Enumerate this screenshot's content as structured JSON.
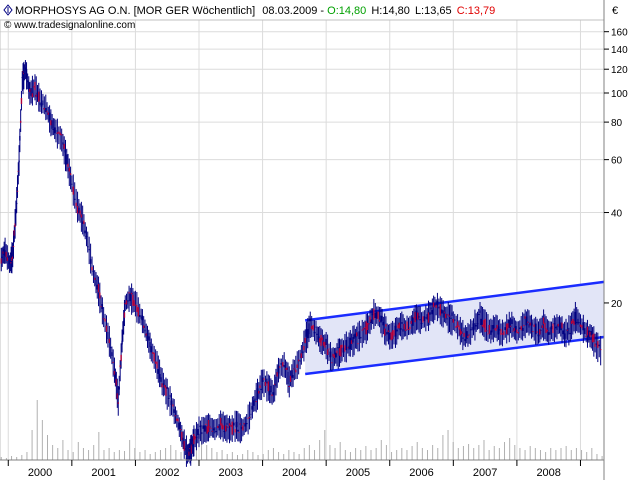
{
  "header": {
    "symbol_icon": "diamond-arrows-icon",
    "title": "MORPHOSYS AG O.N. [MOR GER  Wöchentlich]",
    "date": "08.03.2009",
    "open": "O:14,80",
    "high": "H:14,80",
    "low": "L:13,65",
    "close": "C:13,79",
    "watermark": "© www.tradesignalonline.com",
    "currency": "€"
  },
  "colors": {
    "background": "#ffffff",
    "grid": "#dcdcdc",
    "candle": "#000080",
    "candle_down": "#b0003a",
    "channel_line": "#1a2cff",
    "channel_fill": "#e2e5f7",
    "open_color": "#00a000",
    "close_color": "#e00000",
    "volume": "#b0b0b0"
  },
  "chart_data": {
    "type": "candlestick",
    "title": "MORPHOSYS AG O.N. [MOR GER  Wöchentlich]",
    "y_scale": "log",
    "ylim": [
      6,
      175
    ],
    "xlim": [
      1999.7,
      2009.2
    ],
    "y_ticks": [
      160,
      140,
      120,
      100,
      80,
      60,
      40,
      20
    ],
    "y_tick_labels": [
      "160",
      "140",
      "120",
      "100",
      "80",
      "60",
      "40",
      "20"
    ],
    "x_year_ticks": [
      1999.83,
      2000.83,
      2001.83,
      2002.83,
      2003.83,
      2004.83,
      2005.83,
      2006.83,
      2007.83,
      2008.83
    ],
    "year_labels": [
      {
        "label": "2000",
        "x": 2000.33
      },
      {
        "label": "2001",
        "x": 2001.33
      },
      {
        "label": "2002",
        "x": 2002.33
      },
      {
        "label": "2003",
        "x": 2003.33
      },
      {
        "label": "2004",
        "x": 2004.33
      },
      {
        "label": "2005",
        "x": 2005.33
      },
      {
        "label": "2006",
        "x": 2006.33
      },
      {
        "label": "2007",
        "x": 2007.33
      },
      {
        "label": "2008",
        "x": 2008.33
      }
    ],
    "grid": true,
    "price_path": [
      [
        1999.72,
        28
      ],
      [
        1999.78,
        30
      ],
      [
        1999.85,
        27
      ],
      [
        1999.9,
        29
      ],
      [
        1999.95,
        40
      ],
      [
        2000.0,
        60
      ],
      [
        2000.05,
        110
      ],
      [
        2000.1,
        120
      ],
      [
        2000.17,
        100
      ],
      [
        2000.25,
        105
      ],
      [
        2000.33,
        95
      ],
      [
        2000.42,
        90
      ],
      [
        2000.5,
        80
      ],
      [
        2000.58,
        75
      ],
      [
        2000.67,
        70
      ],
      [
        2000.75,
        60
      ],
      [
        2000.83,
        50
      ],
      [
        2000.92,
        42
      ],
      [
        2001.0,
        38
      ],
      [
        2001.08,
        32
      ],
      [
        2001.17,
        25
      ],
      [
        2001.25,
        22
      ],
      [
        2001.33,
        18
      ],
      [
        2001.42,
        15
      ],
      [
        2001.5,
        12
      ],
      [
        2001.56,
        9.5
      ],
      [
        2001.62,
        15
      ],
      [
        2001.67,
        20
      ],
      [
        2001.75,
        21
      ],
      [
        2001.83,
        20
      ],
      [
        2001.92,
        18
      ],
      [
        2002.0,
        16
      ],
      [
        2002.08,
        14
      ],
      [
        2002.17,
        12.5
      ],
      [
        2002.25,
        11
      ],
      [
        2002.33,
        10
      ],
      [
        2002.42,
        9
      ],
      [
        2002.5,
        8
      ],
      [
        2002.58,
        7
      ],
      [
        2002.65,
        6.3
      ],
      [
        2002.7,
        6.5
      ],
      [
        2002.75,
        7
      ],
      [
        2002.83,
        7.5
      ],
      [
        2002.92,
        7.6
      ],
      [
        2003.0,
        7.8
      ],
      [
        2003.08,
        7.6
      ],
      [
        2003.17,
        7.9
      ],
      [
        2003.25,
        7.7
      ],
      [
        2003.33,
        7.6
      ],
      [
        2003.42,
        7.9
      ],
      [
        2003.5,
        7.6
      ],
      [
        2003.58,
        8
      ],
      [
        2003.67,
        9
      ],
      [
        2003.75,
        10
      ],
      [
        2003.83,
        11
      ],
      [
        2003.92,
        10.5
      ],
      [
        2004.0,
        10
      ],
      [
        2004.08,
        12
      ],
      [
        2004.17,
        12.5
      ],
      [
        2004.25,
        11
      ],
      [
        2004.33,
        12
      ],
      [
        2004.42,
        13
      ],
      [
        2004.5,
        15
      ],
      [
        2004.58,
        17
      ],
      [
        2004.67,
        16
      ],
      [
        2004.75,
        15
      ],
      [
        2004.83,
        14.5
      ],
      [
        2004.92,
        13
      ],
      [
        2005.0,
        13.5
      ],
      [
        2005.08,
        14
      ],
      [
        2005.17,
        14.5
      ],
      [
        2005.25,
        15
      ],
      [
        2005.33,
        15.5
      ],
      [
        2005.42,
        16
      ],
      [
        2005.5,
        17
      ],
      [
        2005.58,
        18.5
      ],
      [
        2005.67,
        18
      ],
      [
        2005.75,
        16.5
      ],
      [
        2005.83,
        15.5
      ],
      [
        2005.92,
        16
      ],
      [
        2006.0,
        17
      ],
      [
        2006.08,
        16.5
      ],
      [
        2006.17,
        17
      ],
      [
        2006.25,
        18
      ],
      [
        2006.33,
        17.5
      ],
      [
        2006.42,
        18
      ],
      [
        2006.5,
        19
      ],
      [
        2006.58,
        19.5
      ],
      [
        2006.67,
        18.5
      ],
      [
        2006.75,
        18
      ],
      [
        2006.83,
        17.5
      ],
      [
        2006.92,
        16.5
      ],
      [
        2007.0,
        15.5
      ],
      [
        2007.08,
        15.8
      ],
      [
        2007.17,
        17
      ],
      [
        2007.25,
        18
      ],
      [
        2007.33,
        17
      ],
      [
        2007.42,
        16.2
      ],
      [
        2007.5,
        16.8
      ],
      [
        2007.58,
        15.8
      ],
      [
        2007.67,
        16.5
      ],
      [
        2007.75,
        17
      ],
      [
        2007.83,
        16
      ],
      [
        2007.92,
        16.8
      ],
      [
        2008.0,
        17.5
      ],
      [
        2008.08,
        16.5
      ],
      [
        2008.17,
        16
      ],
      [
        2008.25,
        17
      ],
      [
        2008.33,
        16
      ],
      [
        2008.42,
        16.5
      ],
      [
        2008.5,
        17
      ],
      [
        2008.58,
        15.8
      ],
      [
        2008.67,
        16.5
      ],
      [
        2008.75,
        18
      ],
      [
        2008.83,
        17
      ],
      [
        2008.92,
        16
      ],
      [
        2009.0,
        15.5
      ],
      [
        2009.08,
        14.5
      ],
      [
        2009.17,
        13.79
      ]
    ],
    "channel": {
      "upper": [
        [
          2004.5,
          17.5
        ],
        [
          2009.2,
          23.5
        ]
      ],
      "lower": [
        [
          2004.5,
          11.6
        ],
        [
          2009.2,
          15.4
        ]
      ]
    },
    "volume": {
      "ylim": [
        0,
        1
      ],
      "values": [
        0.03,
        0.02,
        0.04,
        0.03,
        0.05,
        0.08,
        0.3,
        0.6,
        0.4,
        0.25,
        0.15,
        0.12,
        0.2,
        0.1,
        0.08,
        0.18,
        0.12,
        0.1,
        0.15,
        0.28,
        0.1,
        0.12,
        0.08,
        0.1,
        0.09,
        0.2,
        0.12,
        0.08,
        0.1,
        0.06,
        0.08,
        0.1,
        0.12,
        0.15,
        0.1,
        0.08,
        0.14,
        0.18,
        0.2,
        0.35,
        0.15,
        0.12,
        0.08,
        0.1,
        0.06,
        0.08,
        0.05,
        0.06,
        0.1,
        0.08,
        0.05,
        0.06,
        0.1,
        0.12,
        0.08,
        0.06,
        0.1,
        0.08,
        0.06,
        0.12,
        0.15,
        0.1,
        0.2,
        0.3,
        0.15,
        0.12,
        0.18,
        0.1,
        0.08,
        0.12,
        0.1,
        0.14,
        0.1,
        0.12,
        0.2,
        0.15,
        0.08,
        0.1,
        0.12,
        0.1,
        0.14,
        0.18,
        0.12,
        0.1,
        0.15,
        0.12,
        0.25,
        0.3,
        0.18,
        0.12,
        0.14,
        0.16,
        0.12,
        0.15,
        0.2,
        0.1,
        0.14,
        0.12,
        0.18,
        0.22,
        0.15,
        0.12,
        0.1,
        0.14,
        0.12,
        0.1,
        0.08,
        0.12,
        0.1,
        0.12,
        0.14,
        0.1,
        0.12,
        0.1,
        0.08,
        0.12,
        0.06,
        0.04
      ]
    }
  }
}
